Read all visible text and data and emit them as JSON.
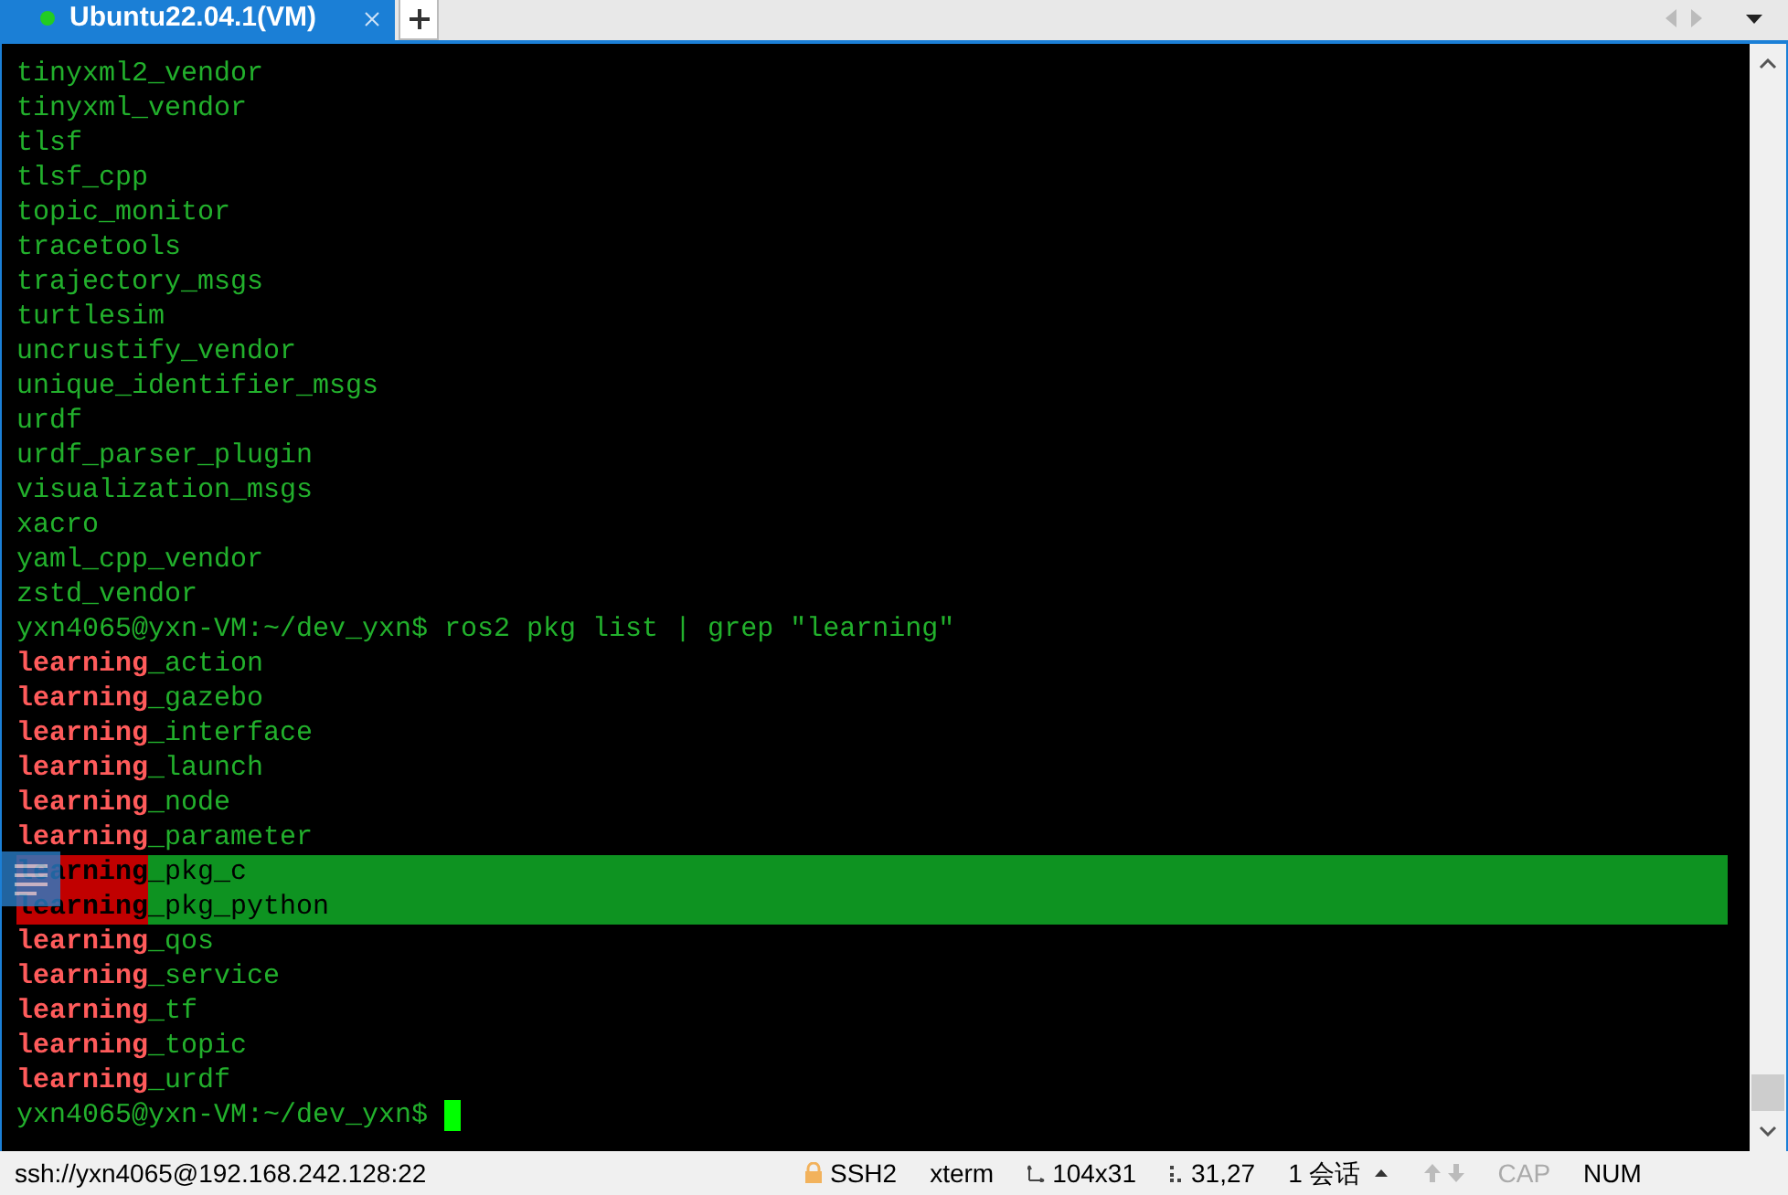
{
  "tabs": [
    {
      "label": "Ubuntu22.04.1(VM)",
      "selected": true,
      "connected": true
    }
  ],
  "terminal": {
    "cursor": true,
    "lines": [
      {
        "selected": false,
        "segments": [
          {
            "kind": "plain",
            "text": "tinyxml2_vendor"
          }
        ]
      },
      {
        "selected": false,
        "segments": [
          {
            "kind": "plain",
            "text": "tinyxml_vendor"
          }
        ]
      },
      {
        "selected": false,
        "segments": [
          {
            "kind": "plain",
            "text": "tlsf"
          }
        ]
      },
      {
        "selected": false,
        "segments": [
          {
            "kind": "plain",
            "text": "tlsf_cpp"
          }
        ]
      },
      {
        "selected": false,
        "segments": [
          {
            "kind": "plain",
            "text": "topic_monitor"
          }
        ]
      },
      {
        "selected": false,
        "segments": [
          {
            "kind": "plain",
            "text": "tracetools"
          }
        ]
      },
      {
        "selected": false,
        "segments": [
          {
            "kind": "plain",
            "text": "trajectory_msgs"
          }
        ]
      },
      {
        "selected": false,
        "segments": [
          {
            "kind": "plain",
            "text": "turtlesim"
          }
        ]
      },
      {
        "selected": false,
        "segments": [
          {
            "kind": "plain",
            "text": "uncrustify_vendor"
          }
        ]
      },
      {
        "selected": false,
        "segments": [
          {
            "kind": "plain",
            "text": "unique_identifier_msgs"
          }
        ]
      },
      {
        "selected": false,
        "segments": [
          {
            "kind": "plain",
            "text": "urdf"
          }
        ]
      },
      {
        "selected": false,
        "segments": [
          {
            "kind": "plain",
            "text": "urdf_parser_plugin"
          }
        ]
      },
      {
        "selected": false,
        "segments": [
          {
            "kind": "plain",
            "text": "visualization_msgs"
          }
        ]
      },
      {
        "selected": false,
        "segments": [
          {
            "kind": "plain",
            "text": "xacro"
          }
        ]
      },
      {
        "selected": false,
        "segments": [
          {
            "kind": "plain",
            "text": "yaml_cpp_vendor"
          }
        ]
      },
      {
        "selected": false,
        "segments": [
          {
            "kind": "plain",
            "text": "zstd_vendor"
          }
        ]
      },
      {
        "selected": false,
        "segments": [
          {
            "kind": "plain",
            "text": "yxn4065@yxn-VM:~/dev_yxn$ ros2 pkg list | grep \"learning\""
          }
        ]
      },
      {
        "selected": false,
        "segments": [
          {
            "kind": "match",
            "text": "learning"
          },
          {
            "kind": "plain",
            "text": "_action"
          }
        ]
      },
      {
        "selected": false,
        "segments": [
          {
            "kind": "match",
            "text": "learning"
          },
          {
            "kind": "plain",
            "text": "_gazebo"
          }
        ]
      },
      {
        "selected": false,
        "segments": [
          {
            "kind": "match",
            "text": "learning"
          },
          {
            "kind": "plain",
            "text": "_interface"
          }
        ]
      },
      {
        "selected": false,
        "segments": [
          {
            "kind": "match",
            "text": "learning"
          },
          {
            "kind": "plain",
            "text": "_launch"
          }
        ]
      },
      {
        "selected": false,
        "segments": [
          {
            "kind": "match",
            "text": "learning"
          },
          {
            "kind": "plain",
            "text": "_node"
          }
        ]
      },
      {
        "selected": false,
        "segments": [
          {
            "kind": "match",
            "text": "learning"
          },
          {
            "kind": "plain",
            "text": "_parameter"
          }
        ]
      },
      {
        "selected": true,
        "segments": [
          {
            "kind": "match",
            "text": "learning"
          },
          {
            "kind": "plain",
            "text": "_pkg_c"
          }
        ]
      },
      {
        "selected": true,
        "segments": [
          {
            "kind": "match",
            "text": "learning"
          },
          {
            "kind": "plain",
            "text": "_pkg_python"
          }
        ]
      },
      {
        "selected": false,
        "segments": [
          {
            "kind": "match",
            "text": "learning"
          },
          {
            "kind": "plain",
            "text": "_qos"
          }
        ]
      },
      {
        "selected": false,
        "segments": [
          {
            "kind": "match",
            "text": "learning"
          },
          {
            "kind": "plain",
            "text": "_service"
          }
        ]
      },
      {
        "selected": false,
        "segments": [
          {
            "kind": "match",
            "text": "learning"
          },
          {
            "kind": "plain",
            "text": "_tf"
          }
        ]
      },
      {
        "selected": false,
        "segments": [
          {
            "kind": "match",
            "text": "learning"
          },
          {
            "kind": "plain",
            "text": "_topic"
          }
        ]
      },
      {
        "selected": false,
        "segments": [
          {
            "kind": "match",
            "text": "learning"
          },
          {
            "kind": "plain",
            "text": "_urdf"
          }
        ]
      },
      {
        "selected": false,
        "segments": [
          {
            "kind": "plain",
            "text": "yxn4065@yxn-VM:~/dev_yxn$ "
          }
        ]
      }
    ]
  },
  "status_bar": [
    {
      "kind": "address",
      "text": "ssh://yxn4065@192.168.242.128:22",
      "on": true
    },
    {
      "kind": "protocol",
      "text": "SSH2",
      "on": true
    },
    {
      "kind": "plain",
      "text": "xterm",
      "on": true
    },
    {
      "kind": "size",
      "text": "104x31",
      "on": true
    },
    {
      "kind": "position",
      "text": "31,27",
      "on": true
    },
    {
      "kind": "sessions",
      "text": "1 会话",
      "on": true
    },
    {
      "kind": "plain",
      "text": "CAP",
      "on": false
    },
    {
      "kind": "plain",
      "text": "NUM",
      "on": true
    }
  ]
}
